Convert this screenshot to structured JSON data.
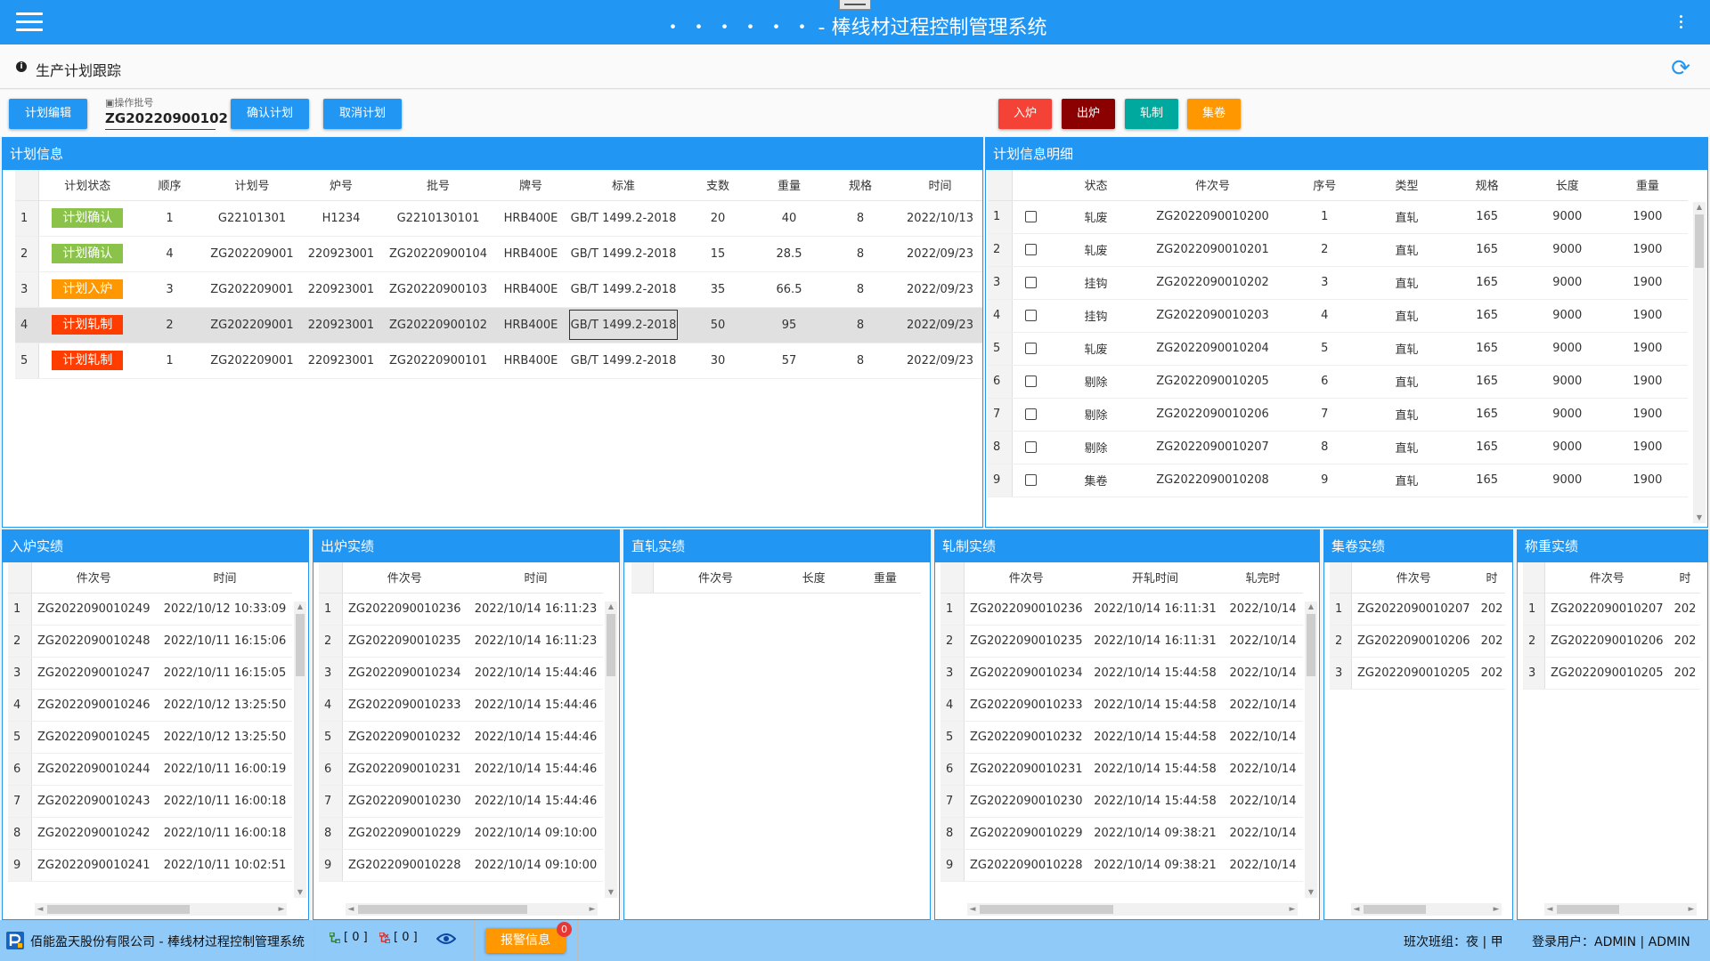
{
  "app": {
    "title": "・ ・ ・ ・ ・ ・ - 棒线材过程控制管理系统",
    "page_title": "生产计划跟踪"
  },
  "colors": {
    "primary": "#2196f3",
    "confirm": "#8bc34a",
    "in_furnace": "#ff9800",
    "rolling": "#ff3d00",
    "red": "#f44336",
    "dark_red": "#8b0000",
    "green": "#00a99d",
    "orange": "#ff9800"
  },
  "toolbar": {
    "edit_plan": "计划编辑",
    "batch_label": "操作批号",
    "batch_value": "ZG20220900102",
    "confirm_plan": "确认计划",
    "cancel_plan": "取消计划",
    "in_furnace": "入炉",
    "out_furnace": "出炉",
    "rolling": "轧制",
    "coiling": "集卷"
  },
  "plan_info": {
    "title": "计划信息",
    "columns": [
      "",
      "计划状态",
      "顺序",
      "计划号",
      "炉号",
      "批号",
      "牌号",
      "标准",
      "支数",
      "重量",
      "规格",
      "时间"
    ],
    "rows": [
      {
        "idx": "1",
        "status": "计划确认",
        "status_color": "#8bc34a",
        "seq": "1",
        "plan_no": "G22101301",
        "heat_no": "H1234",
        "batch_no": "G2210130101",
        "grade": "HRB400E",
        "standard": "GB/T 1499.2-2018",
        "count": "20",
        "weight": "40",
        "spec": "8",
        "time": "2022/10/13"
      },
      {
        "idx": "2",
        "status": "计划确认",
        "status_color": "#8bc34a",
        "seq": "4",
        "plan_no": "ZG202209001",
        "heat_no": "220923001",
        "batch_no": "ZG20220900104",
        "grade": "HRB400E",
        "standard": "GB/T 1499.2-2018",
        "count": "15",
        "weight": "28.5",
        "spec": "8",
        "time": "2022/09/23"
      },
      {
        "idx": "3",
        "status": "计划入炉",
        "status_color": "#ff9800",
        "seq": "3",
        "plan_no": "ZG202209001",
        "heat_no": "220923001",
        "batch_no": "ZG20220900103",
        "grade": "HRB400E",
        "standard": "GB/T 1499.2-2018",
        "count": "35",
        "weight": "66.5",
        "spec": "8",
        "time": "2022/09/23"
      },
      {
        "idx": "4",
        "status": "计划轧制",
        "status_color": "#ff3d00",
        "seq": "2",
        "plan_no": "ZG202209001",
        "heat_no": "220923001",
        "batch_no": "ZG20220900102",
        "grade": "HRB400E",
        "standard": "GB/T 1499.2-2018",
        "count": "50",
        "weight": "95",
        "spec": "8",
        "time": "2022/09/23"
      },
      {
        "idx": "5",
        "status": "计划轧制",
        "status_color": "#ff3d00",
        "seq": "1",
        "plan_no": "ZG202209001",
        "heat_no": "220923001",
        "batch_no": "ZG20220900101",
        "grade": "HRB400E",
        "standard": "GB/T 1499.2-2018",
        "count": "30",
        "weight": "57",
        "spec": "8",
        "time": "2022/09/23"
      }
    ]
  },
  "plan_detail": {
    "title": "计划信息明细",
    "columns": [
      "",
      "",
      "状态",
      "件次号",
      "序号",
      "类型",
      "规格",
      "长度",
      "重量"
    ],
    "rows": [
      {
        "idx": "1",
        "status": "轧废",
        "piece": "ZG2022090010200",
        "seq": "1",
        "type": "直轧",
        "spec": "165",
        "length": "9000",
        "weight": "1900"
      },
      {
        "idx": "2",
        "status": "轧废",
        "piece": "ZG2022090010201",
        "seq": "2",
        "type": "直轧",
        "spec": "165",
        "length": "9000",
        "weight": "1900"
      },
      {
        "idx": "3",
        "status": "挂钩",
        "piece": "ZG2022090010202",
        "seq": "3",
        "type": "直轧",
        "spec": "165",
        "length": "9000",
        "weight": "1900"
      },
      {
        "idx": "4",
        "status": "挂钩",
        "piece": "ZG2022090010203",
        "seq": "4",
        "type": "直轧",
        "spec": "165",
        "length": "9000",
        "weight": "1900"
      },
      {
        "idx": "5",
        "status": "轧废",
        "piece": "ZG2022090010204",
        "seq": "5",
        "type": "直轧",
        "spec": "165",
        "length": "9000",
        "weight": "1900"
      },
      {
        "idx": "6",
        "status": "剔除",
        "piece": "ZG2022090010205",
        "seq": "6",
        "type": "直轧",
        "spec": "165",
        "length": "9000",
        "weight": "1900"
      },
      {
        "idx": "7",
        "status": "剔除",
        "piece": "ZG2022090010206",
        "seq": "7",
        "type": "直轧",
        "spec": "165",
        "length": "9000",
        "weight": "1900"
      },
      {
        "idx": "8",
        "status": "剔除",
        "piece": "ZG2022090010207",
        "seq": "8",
        "type": "直轧",
        "spec": "165",
        "length": "9000",
        "weight": "1900"
      },
      {
        "idx": "9",
        "status": "集卷",
        "piece": "ZG2022090010208",
        "seq": "9",
        "type": "直轧",
        "spec": "165",
        "length": "9000",
        "weight": "1900"
      }
    ]
  },
  "charge": {
    "title": "入炉实绩",
    "columns": [
      "",
      "件次号",
      "时间"
    ],
    "rows": [
      [
        "1",
        "ZG2022090010249",
        "2022/10/12 10:33:09"
      ],
      [
        "2",
        "ZG2022090010248",
        "2022/10/11 16:15:06"
      ],
      [
        "3",
        "ZG2022090010247",
        "2022/10/11 16:15:05"
      ],
      [
        "4",
        "ZG2022090010246",
        "2022/10/12 13:25:50"
      ],
      [
        "5",
        "ZG2022090010245",
        "2022/10/12 13:25:50"
      ],
      [
        "6",
        "ZG2022090010244",
        "2022/10/11 16:00:19"
      ],
      [
        "7",
        "ZG2022090010243",
        "2022/10/11 16:00:18"
      ],
      [
        "8",
        "ZG2022090010242",
        "2022/10/11 16:00:18"
      ],
      [
        "9",
        "ZG2022090010241",
        "2022/10/11 10:02:51"
      ]
    ]
  },
  "discharge": {
    "title": "出炉实绩",
    "columns": [
      "",
      "件次号",
      "时间"
    ],
    "rows": [
      [
        "1",
        "ZG2022090010236",
        "2022/10/14 16:11:23"
      ],
      [
        "2",
        "ZG2022090010235",
        "2022/10/14 16:11:23"
      ],
      [
        "3",
        "ZG2022090010234",
        "2022/10/14 15:44:46"
      ],
      [
        "4",
        "ZG2022090010233",
        "2022/10/14 15:44:46"
      ],
      [
        "5",
        "ZG2022090010232",
        "2022/10/14 15:44:46"
      ],
      [
        "6",
        "ZG2022090010231",
        "2022/10/14 15:44:46"
      ],
      [
        "7",
        "ZG2022090010230",
        "2022/10/14 15:44:46"
      ],
      [
        "8",
        "ZG2022090010229",
        "2022/10/14 09:10:00"
      ],
      [
        "9",
        "ZG2022090010228",
        "2022/10/14 09:10:00"
      ]
    ]
  },
  "direct_roll": {
    "title": "直轧实绩",
    "columns": [
      "",
      "件次号",
      "长度",
      "重量"
    ],
    "rows": []
  },
  "rolling_result": {
    "title": "轧制实绩",
    "columns": [
      "",
      "件次号",
      "开轧时间",
      "轧完时"
    ],
    "rows": [
      [
        "1",
        "ZG2022090010236",
        "2022/10/14 16:11:31",
        "2022/10/14"
      ],
      [
        "2",
        "ZG2022090010235",
        "2022/10/14 16:11:31",
        "2022/10/14"
      ],
      [
        "3",
        "ZG2022090010234",
        "2022/10/14 15:44:58",
        "2022/10/14"
      ],
      [
        "4",
        "ZG2022090010233",
        "2022/10/14 15:44:58",
        "2022/10/14"
      ],
      [
        "5",
        "ZG2022090010232",
        "2022/10/14 15:44:58",
        "2022/10/14"
      ],
      [
        "6",
        "ZG2022090010231",
        "2022/10/14 15:44:58",
        "2022/10/14"
      ],
      [
        "7",
        "ZG2022090010230",
        "2022/10/14 15:44:58",
        "2022/10/14"
      ],
      [
        "8",
        "ZG2022090010229",
        "2022/10/14 09:38:21",
        "2022/10/14"
      ],
      [
        "9",
        "ZG2022090010228",
        "2022/10/14 09:38:21",
        "2022/10/14"
      ]
    ]
  },
  "coil_result": {
    "title": "集卷实绩",
    "columns": [
      "",
      "件次号",
      "时"
    ],
    "rows": [
      [
        "1",
        "ZG2022090010207",
        "202"
      ],
      [
        "2",
        "ZG2022090010206",
        "202"
      ],
      [
        "3",
        "ZG2022090010205",
        "202"
      ]
    ]
  },
  "weigh_result": {
    "title": "称重实绩",
    "columns": [
      "",
      "件次号",
      "时"
    ],
    "rows": [
      [
        "1",
        "ZG2022090010207",
        "202"
      ],
      [
        "2",
        "ZG2022090010206",
        "202"
      ],
      [
        "3",
        "ZG2022090010205",
        "202"
      ]
    ]
  },
  "status": {
    "company": "佰能盈天股份有限公司 - 棒线材过程控制管理系统",
    "net1": "[ 0 ]",
    "net2": "[ 0 ]",
    "alarm": "报警信息",
    "alarm_count": "0",
    "shift": "班次班组：夜 | 甲",
    "user": "登录用户：ADMIN | ADMIN"
  }
}
